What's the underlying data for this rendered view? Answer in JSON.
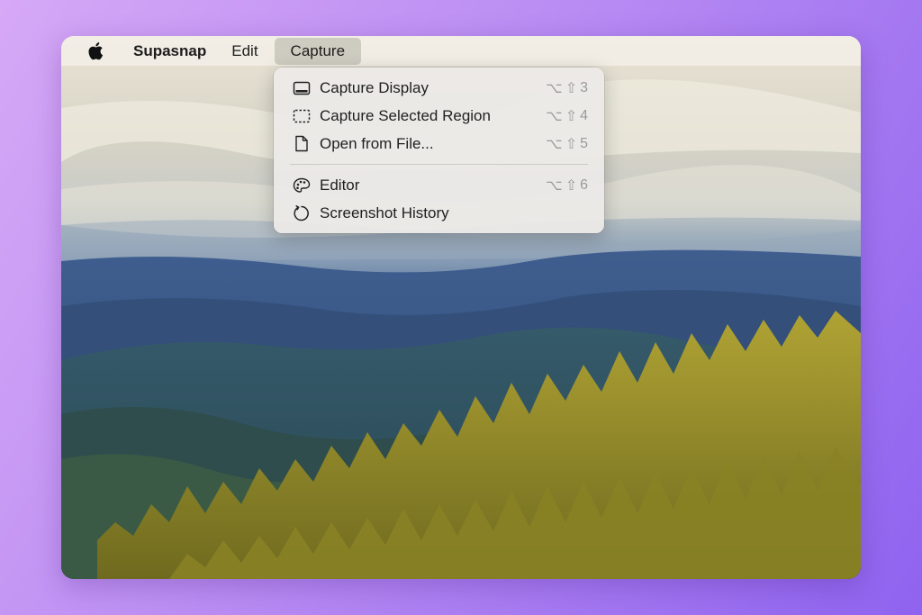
{
  "menubar": {
    "apple_icon": "apple-icon",
    "app_name": "Supasnap",
    "edit": "Edit",
    "capture": "Capture"
  },
  "dropdown": {
    "items": [
      {
        "label": "Capture Display",
        "icon": "display-icon",
        "key": "3"
      },
      {
        "label": "Capture Selected Region",
        "icon": "region-icon",
        "key": "4"
      },
      {
        "label": "Open from File...",
        "icon": "document-icon",
        "key": "5"
      },
      {
        "label": "Editor",
        "icon": "palette-icon",
        "key": "6"
      },
      {
        "label": "Screenshot History",
        "icon": "history-icon",
        "key": ""
      }
    ],
    "option_glyph": "⌥",
    "shift_glyph": "⇧"
  },
  "colors": {
    "background_start": "#d6a8f6",
    "background_end": "#8f63ef",
    "menu_highlight": "#c8c4ba"
  }
}
